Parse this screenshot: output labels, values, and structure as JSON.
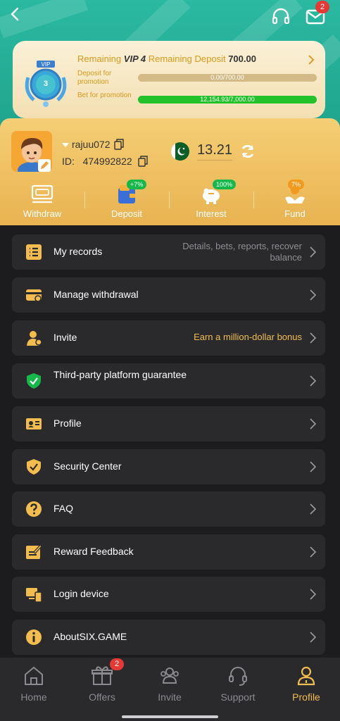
{
  "header": {
    "mail_badge": "2"
  },
  "vip": {
    "level_badge": "3",
    "remaining_prefix": "Remaining",
    "level": "VIP 4",
    "remaining_deposit_label": "Remaining Deposit",
    "remaining_deposit_amount": "700.00",
    "deposit_label": "Deposit for promotion",
    "deposit_progress_text": "0.00/700.00",
    "deposit_progress": 0.0,
    "bet_label": "Bet for promotion",
    "bet_progress_text": "12,154.93/7,000.00",
    "bet_progress": 1.0
  },
  "user": {
    "username": "rajuu072",
    "id_label": "ID:",
    "id_value": "474992822",
    "balance": "13.21"
  },
  "actions": [
    {
      "label": "Withdraw",
      "badge": ""
    },
    {
      "label": "Deposit",
      "badge": "+7%"
    },
    {
      "label": "Interest",
      "badge": "100%"
    },
    {
      "label": "Fund",
      "badge": "7%"
    }
  ],
  "menu": [
    {
      "label": "My records",
      "sub": "Details, bets, reports, recover balance",
      "icon": "records-icon"
    },
    {
      "label": "Manage withdrawal",
      "sub": "",
      "icon": "card-icon"
    },
    {
      "label": "Invite",
      "sub": "Earn a million-dollar bonus",
      "icon": "invite-icon"
    },
    {
      "label": "Third-party platform guarantee",
      "sub": "",
      "icon": "shield-check-icon"
    },
    {
      "label": "Profile",
      "sub": "",
      "icon": "id-card-icon"
    },
    {
      "label": "Security Center",
      "sub": "",
      "icon": "security-icon"
    },
    {
      "label": "FAQ",
      "sub": "",
      "icon": "question-icon"
    },
    {
      "label": "Reward Feedback",
      "sub": "",
      "icon": "feedback-icon"
    },
    {
      "label": "Login device",
      "sub": "",
      "icon": "device-icon"
    },
    {
      "label": "AboutSIX.GAME",
      "sub": "",
      "icon": "info-icon"
    }
  ],
  "nav": [
    {
      "label": "Home"
    },
    {
      "label": "Offers",
      "badge": "2"
    },
    {
      "label": "Invite"
    },
    {
      "label": "Support"
    },
    {
      "label": "Profile",
      "active": true
    }
  ],
  "colors": {
    "accent": "#f2bd4e",
    "teal": "#2bb9a1",
    "panel": "#2a2a2d",
    "background": "#1c1c1e"
  }
}
